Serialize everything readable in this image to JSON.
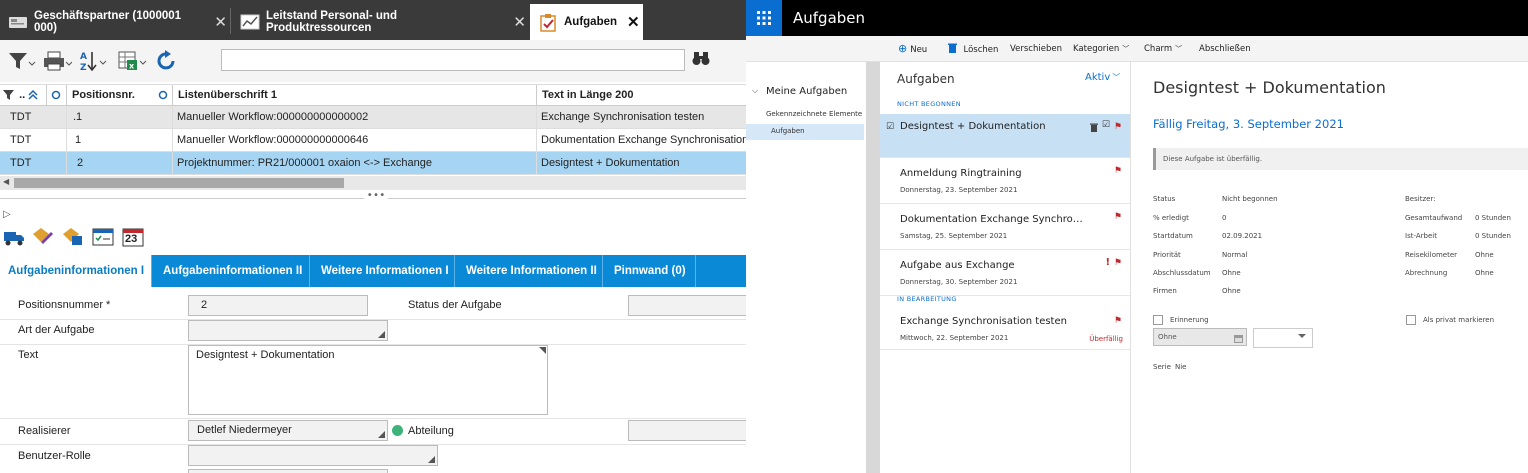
{
  "left_app": {
    "window_tabs": [
      {
        "label": "Geschäftspartner (1000001 000)",
        "icon": "id-card-icon"
      },
      {
        "label": "Leitstand Personal- und Produktressourcen",
        "icon": "chart-icon"
      },
      {
        "label": "Aufgaben",
        "icon": "clipboard-check-icon"
      }
    ],
    "tab_close": "✕",
    "toolbar": {
      "icons": [
        "filter-icon",
        "print-icon",
        "sort-az-icon",
        "export-excel-icon",
        "refresh-icon"
      ],
      "search_value": "",
      "search_icon": "binoculars-icon"
    },
    "grid": {
      "columns": [
        "..",
        "Positionsnr.",
        "Listenüberschrift 1",
        "Text in Länge 200"
      ],
      "rows": [
        {
          "type": "TDT",
          "pos": ".1",
          "title": "Manueller Workflow:000000000000002",
          "text": "Exchange Synchronisation testen"
        },
        {
          "type": "TDT",
          "pos": "1",
          "title": "Manueller Workflow:000000000000646",
          "text": "Dokumentation Exchange Synchronisation"
        },
        {
          "type": "TDT",
          "pos": "2",
          "title": "Projektnummer: PR21/000001 oxaion <-> Exchange",
          "text": "Designtest + Dokumentation"
        }
      ],
      "selected_row": 2,
      "splitter": "• • •",
      "expander": "▷"
    },
    "detail_toolbar_icons": [
      "truck-icon",
      "tag-edit-icon",
      "tag-assign-icon",
      "checklist-icon",
      "calendar-icon"
    ],
    "calendar_day": "23",
    "detail_tabs": [
      "Aufgabeninformationen I",
      "Aufgabeninformationen II",
      "Weitere Informationen I",
      "Weitere Informationen II",
      "Pinnwand (0)"
    ],
    "active_detail_tab": 0,
    "form": {
      "positionsnummer_label": "Positionsnummer *",
      "positionsnummer_value": "2",
      "status_label": "Status der Aufgabe",
      "status_value": "",
      "art_label": "Art der Aufgabe",
      "art_value": "",
      "text_label": "Text",
      "text_value": "Designtest + Dokumentation",
      "realisierer_label": "Realisierer",
      "realisierer_value": "Detlef Niedermeyer",
      "abteilung_label": "Abteilung",
      "abteilung_value": "",
      "benutzer_label": "Benutzer-Rolle",
      "benutzer_value": ""
    },
    "colors": {
      "tabbar": "#3a3a3a",
      "detail_tabs": "#0a8ad6",
      "selected_row": "#a6d5f3",
      "status_dot": "#3db37a"
    }
  },
  "right_app": {
    "title": "Aufgaben",
    "commands": [
      {
        "label": "Neu",
        "icon": "plus-circle-icon"
      },
      {
        "label": "Löschen",
        "icon": "trash-icon"
      },
      {
        "label": "Verschieben"
      },
      {
        "label": "Kategorien",
        "dropdown": true
      },
      {
        "label": "Charm",
        "dropdown": true
      },
      {
        "label": "Abschließen"
      }
    ],
    "nav": {
      "root": "Meine Aufgaben",
      "items": [
        "Gekennzeichnete Elemente",
        "Aufgaben"
      ],
      "selected": 1
    },
    "list": {
      "header": "Aufgaben",
      "filter": "Aktiv",
      "sections": [
        {
          "label": "NICHT BEGONNEN",
          "items": [
            {
              "title": "Designtest + Dokumentation",
              "date": "",
              "selected": true
            },
            {
              "title": "Anmeldung Ringtraining",
              "date": "Donnerstag, 23. September 2021"
            },
            {
              "title": "Dokumentation Exchange Synchronisation",
              "date": "Samstag, 25. September 2021"
            },
            {
              "title": "Aufgabe aus Exchange",
              "date": "Donnerstag, 30. September 2021",
              "important": "!"
            }
          ]
        },
        {
          "label": "IN BEARBEITUNG",
          "items": [
            {
              "title": "Exchange Synchronisation testen",
              "date": "Mittwoch, 22. September 2021",
              "status": "Überfällig"
            }
          ]
        }
      ]
    },
    "detail": {
      "title": "Designtest + Dokumentation",
      "due": "Fällig Freitag, 3. September 2021",
      "overdue_notice": "Diese Aufgabe ist überfällig.",
      "left_fields": [
        {
          "label": "Status",
          "value": "Nicht begonnen"
        },
        {
          "label": "% erledigt",
          "value": "0"
        },
        {
          "label": "Startdatum",
          "value": "02.09.2021"
        },
        {
          "label": "Priorität",
          "value": "Normal"
        },
        {
          "label": "Abschlussdatum",
          "value": "Ohne"
        },
        {
          "label": "Firmen",
          "value": "Ohne"
        }
      ],
      "right_fields": [
        {
          "label": "Besitzer:",
          "value": ""
        },
        {
          "label": "Gesamtaufwand",
          "value": "0 Stunden"
        },
        {
          "label": "Ist-Arbeit",
          "value": "0 Stunden"
        },
        {
          "label": "Reisekilometer",
          "value": "Ohne"
        },
        {
          "label": "Abrechnung",
          "value": "Ohne"
        }
      ],
      "reminder_label": "Erinnerung",
      "reminder_value": "Ohne",
      "private_label": "Als privat markieren",
      "series_label": "Serie",
      "series_value": "Nie"
    },
    "colors": {
      "accent": "#0a6ed1",
      "flag": "#c0282d",
      "selected_item": "#c7e0f4"
    }
  }
}
